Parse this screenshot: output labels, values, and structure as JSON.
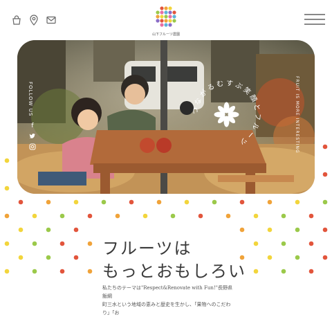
{
  "header": {
    "logo_text": "山下フルーツ農園",
    "icons": [
      "bag-icon",
      "location-pin-icon",
      "mail-icon",
      "menu-icon"
    ]
  },
  "hero": {
    "follow_label": "FOLLOW US",
    "circle_text": "つながるむすぶ笑顔とフルーツ",
    "side_copy": "FRUIT IS MORE INTERESTING"
  },
  "section": {
    "heading_line1": "フルーツは",
    "heading_line2": "もっとおもしろい",
    "body_line1": "私たちのテーマは\"Respect&Renovate with Fun!\"長野県飯綱",
    "body_line2": "町三水という地域の恵みと歴史を生かし、「果物へのこだわり」「お"
  },
  "colors": {
    "red": "#e2553c",
    "orange": "#f0a33a",
    "yellow": "#f2d53c",
    "green": "#9bc94a"
  }
}
